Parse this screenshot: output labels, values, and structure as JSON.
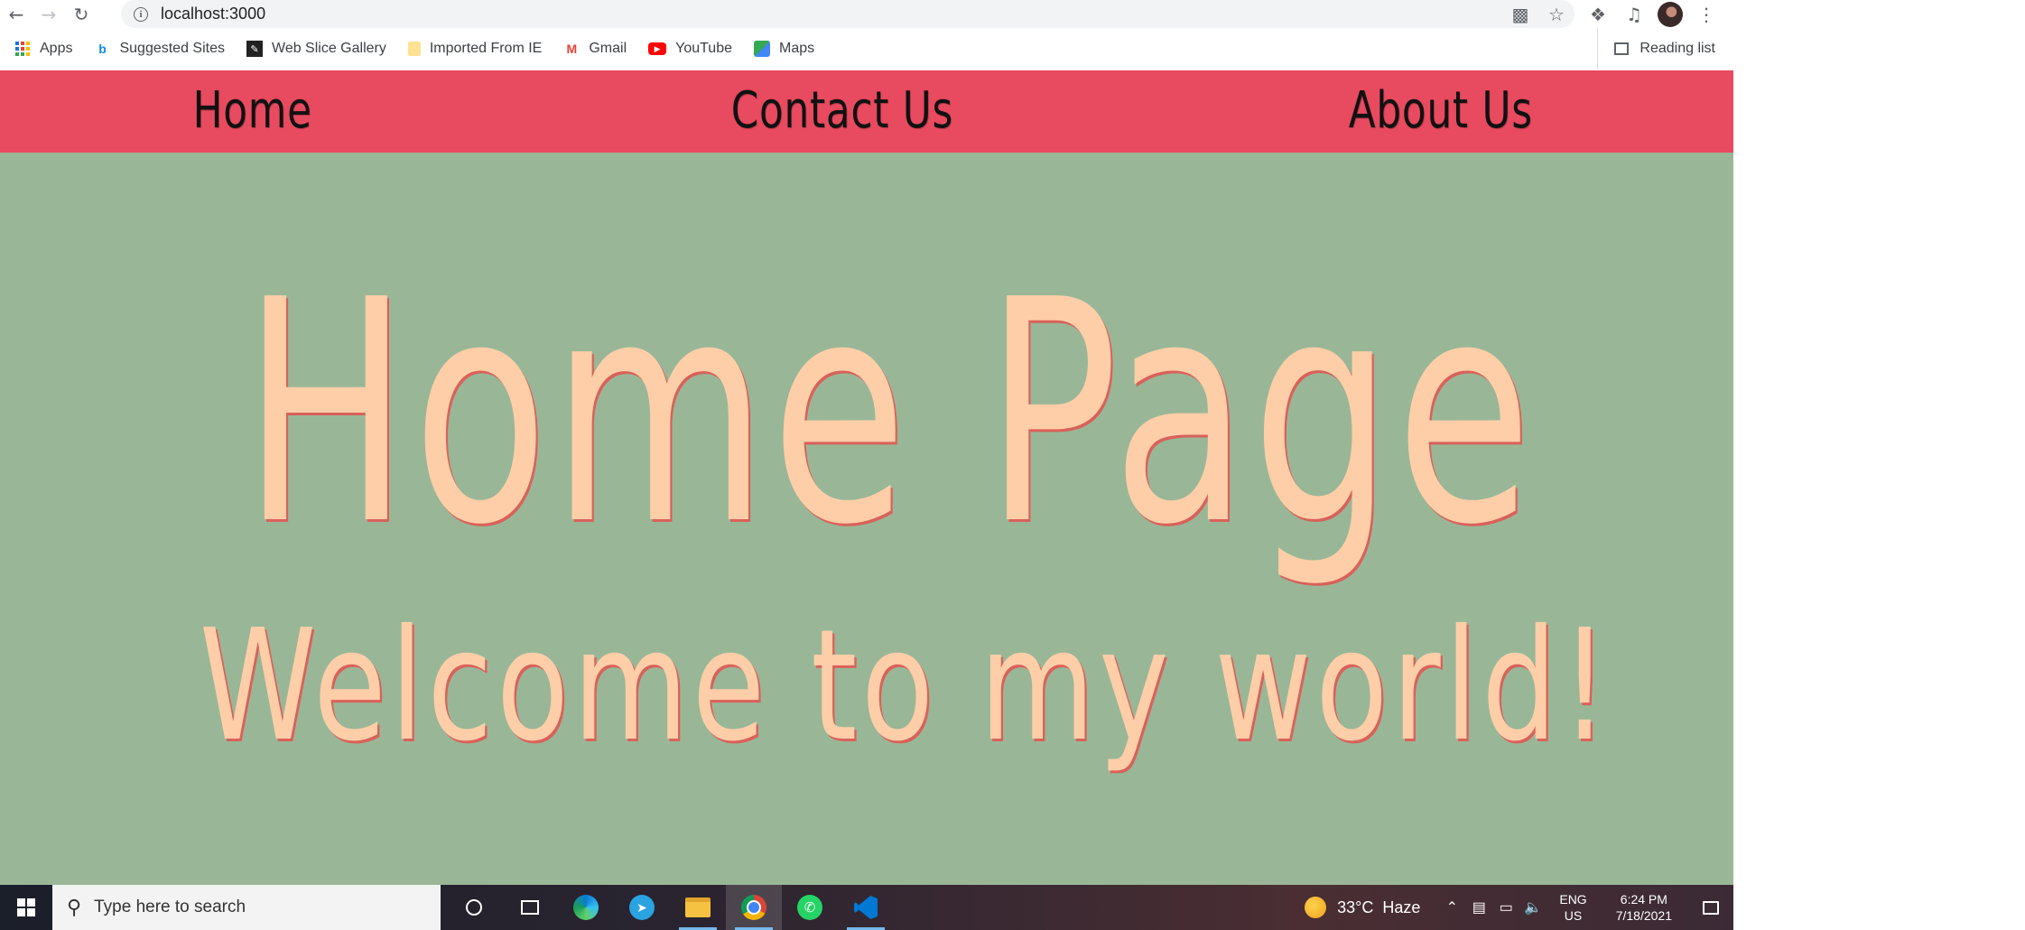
{
  "browser": {
    "url": "localhost:3000",
    "bookmarks": [
      {
        "label": "Apps",
        "icon": "apps-grid-icon"
      },
      {
        "label": "Suggested Sites",
        "icon": "bing-icon"
      },
      {
        "label": "Web Slice Gallery",
        "icon": "web-slice-icon"
      },
      {
        "label": "Imported From IE",
        "icon": "folder-icon"
      },
      {
        "label": "Gmail",
        "icon": "gmail-icon"
      },
      {
        "label": "YouTube",
        "icon": "youtube-icon"
      },
      {
        "label": "Maps",
        "icon": "maps-icon"
      }
    ],
    "reading_list": "Reading list"
  },
  "site": {
    "nav": [
      "Home",
      "Contact Us",
      "About Us"
    ],
    "title": "Home Page",
    "subtitle": "Welcome to my world!",
    "colors": {
      "nav_bg": "#e84a5f",
      "page_bg": "#99b797",
      "hero_text": "#fecea8",
      "hero_shadow": "#d9615a"
    }
  },
  "taskbar": {
    "search_placeholder": "Type here to search",
    "weather": "33°C  Haze",
    "lang_line1": "ENG",
    "lang_line2": "US",
    "time": "6:24 PM",
    "date": "7/18/2021"
  }
}
